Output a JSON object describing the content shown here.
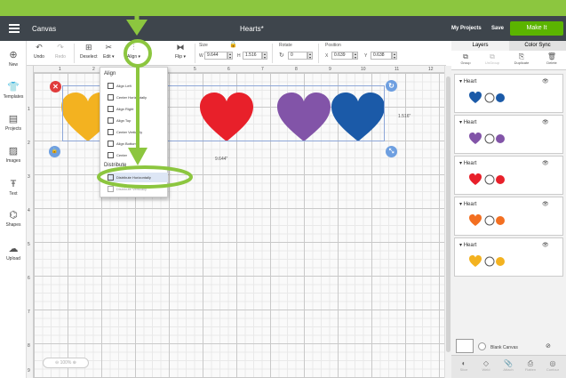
{
  "app": {
    "brand": "Canvas",
    "title": "Hearts*",
    "my_projects": "My Projects",
    "save": "Save",
    "make_it": "Make It"
  },
  "toolbar": {
    "undo": "Undo",
    "redo": "Redo",
    "deselect": "Deselect",
    "edit": "Edit",
    "align": "Align",
    "flip": "Flip",
    "size_label": "Size",
    "w_label": "W",
    "w_value": "9.644",
    "h_label": "H",
    "h_value": "1.516",
    "rotate_label": "Rotate",
    "rotate_value": "0",
    "position_label": "Position",
    "x_label": "X",
    "x_value": "0.639",
    "y_label": "Y",
    "y_value": "0.638"
  },
  "leftbar": [
    "New",
    "Templates",
    "Projects",
    "Images",
    "Text",
    "Shapes",
    "Upload"
  ],
  "rulers": {
    "top": [
      "1",
      "2",
      "3",
      "4",
      "5",
      "6",
      "7",
      "8",
      "9",
      "10",
      "11",
      "12"
    ],
    "left": [
      "1",
      "2",
      "3",
      "4",
      "5",
      "6",
      "7",
      "8",
      "9"
    ]
  },
  "canvas": {
    "width_dim": "9.644\"",
    "height_dim": "1.516\"",
    "zoom": "100%"
  },
  "align_menu": {
    "heading_align": "Align",
    "items": [
      "Align Left",
      "Center Horizontally",
      "Align Right",
      "Align Top",
      "Center Vertically",
      "Align Bottom",
      "Center"
    ],
    "heading_distribute": "Distribute",
    "distribute_items": [
      "Distribute Horizontally",
      "Distribute Vertically"
    ]
  },
  "hearts": [
    {
      "color": "#f3b220"
    },
    {
      "color": "#e8202a"
    },
    {
      "color": "#8254a8"
    },
    {
      "color": "#1b5aa8"
    }
  ],
  "right_panel": {
    "tabs": [
      "Layers",
      "Color Sync"
    ],
    "icons": [
      "Group",
      "UnGroup",
      "Duplicate",
      "Delete"
    ],
    "layers": [
      {
        "name": "Heart",
        "color": "#1b5aa8"
      },
      {
        "name": "Heart",
        "color": "#8254a8"
      },
      {
        "name": "Heart",
        "color": "#e8202a"
      },
      {
        "name": "Heart",
        "color": "#f36f21"
      },
      {
        "name": "Heart",
        "color": "#f3b220"
      }
    ],
    "blank_canvas": "Blank Canvas",
    "bottom_tools": [
      "Slice",
      "Weld",
      "Attach",
      "Flatten",
      "Contour"
    ]
  },
  "annotation_color": "#8cc63f"
}
